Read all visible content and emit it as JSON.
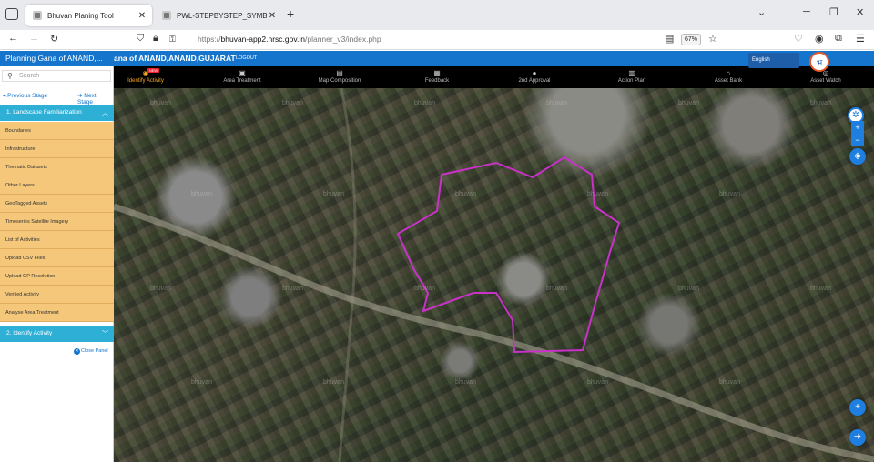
{
  "browser": {
    "tabs": [
      {
        "title": "Bhuvan Planing Tool",
        "active": true
      },
      {
        "title": "PWL-STEPBYSTEP_SYMBOL.pdf",
        "active": false
      }
    ],
    "new_tab": "+",
    "url_prefix": "https://",
    "url_host": "bhuvan-app2.nrsc.gov.in",
    "url_path": "/planner_v3/index.php",
    "zoom": "67%",
    "window_controls": [
      "⌄",
      "─",
      "❐",
      "✕"
    ],
    "icons": [
      "back-icon",
      "forward-icon",
      "reload-icon",
      "shield-icon",
      "lock-icon",
      "key-icon",
      "reader-icon",
      "star-icon",
      "pocket-icon",
      "account-icon",
      "extensions-icon",
      "menu-icon"
    ]
  },
  "app": {
    "title": "Planning Gana of ANAND,...",
    "subtitle": "ana of ANAND,ANAND,GUJARAT",
    "logout": "LOGOUT",
    "language": "English",
    "brand_color": "#1574cc",
    "new_badge": "NEW"
  },
  "toolbar": [
    {
      "label": "Identify Activity",
      "icon": "◉",
      "active": true
    },
    {
      "label": "Area Treatment",
      "icon": "▣",
      "active": false
    },
    {
      "label": "Map Composition",
      "icon": "▤",
      "active": false
    },
    {
      "label": "Feedback",
      "icon": "▦",
      "active": false
    },
    {
      "label": "2nd Approval",
      "icon": "●",
      "active": false
    },
    {
      "label": "Action Plan",
      "icon": "▥",
      "active": false
    },
    {
      "label": "Asset Bank",
      "icon": "⌂",
      "active": false
    },
    {
      "label": "Asset Watch",
      "icon": "◎",
      "active": false
    }
  ],
  "panel": {
    "search_placeholder": "Search",
    "prev_stage": "◂ Previous Stage",
    "next_stage": "➜ Next Stage",
    "section1": "1. Landscape Familiarization",
    "section2": "2. Identify Activity",
    "items": [
      "Boundaries",
      "Infrastructure",
      "Thematic Datasets",
      "Other Layers",
      "GeoTagged Assets",
      "Timeseries Satellite Imagery",
      "List of Activities",
      "Upload CSV Files",
      "Upload GP Resolution",
      "Verified Activity",
      "Analyse Area Treatment"
    ],
    "close_panel": "Close Panel",
    "item_color": "#f5c77a",
    "section_color": "#2eb0d6"
  },
  "map": {
    "watermark": "bhuvan",
    "boundary_color": "#c832c8",
    "controls": [
      "compass-icon",
      "zoom-in-icon",
      "zoom-out-icon",
      "layers-icon",
      "add-icon",
      "arrow-right-icon"
    ]
  }
}
